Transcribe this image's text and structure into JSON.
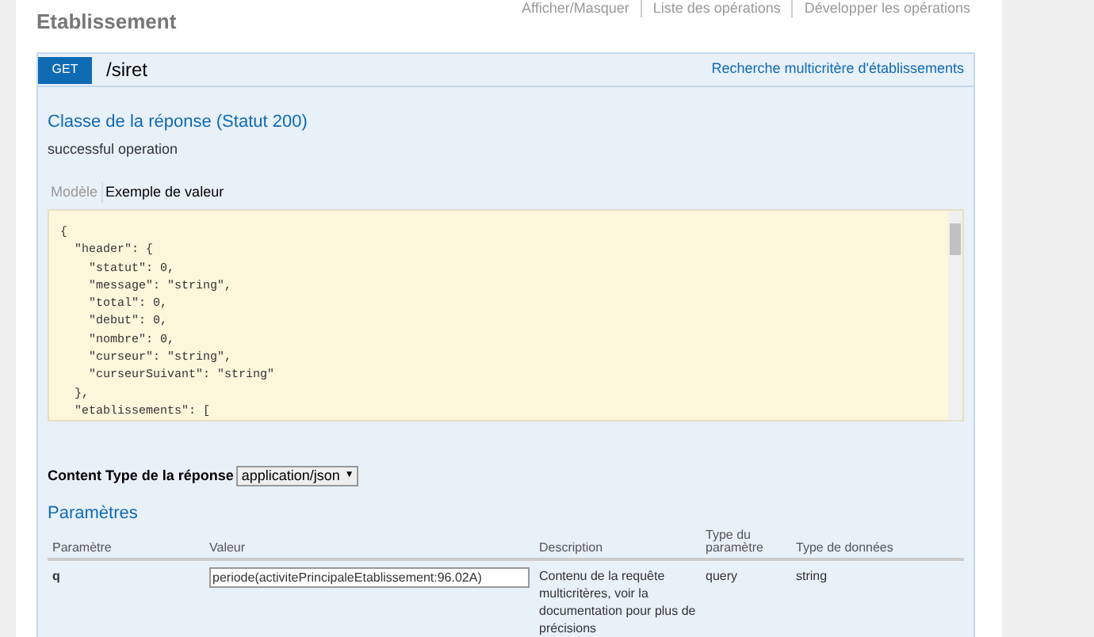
{
  "page_title": "Etablissement",
  "top_links": [
    "Afficher/Masquer",
    "Liste des opérations",
    "Développer les opérations"
  ],
  "operation": {
    "method": "GET",
    "path": "/siret",
    "summary": "Recherche multicritère d'établissements"
  },
  "response": {
    "title": "Classe de la réponse (Statut 200)",
    "description": "successful operation",
    "tabs": [
      {
        "label": "Modèle",
        "selected": false
      },
      {
        "label": "Exemple de valeur",
        "selected": true
      }
    ],
    "code_lines": [
      "{",
      "  \"header\": {",
      "    \"statut\": 0,",
      "    \"message\": \"string\",",
      "    \"total\": 0,",
      "    \"debut\": 0,",
      "    \"nombre\": 0,",
      "    \"curseur\": \"string\",",
      "    \"curseurSuivant\": \"string\"",
      "  },",
      "  \"etablissements\": ["
    ]
  },
  "content_type": {
    "label": "Content Type de la réponse",
    "value": "application/json",
    "caret": "▼"
  },
  "parameters": {
    "title": "Paramètres",
    "columns": [
      "Paramètre",
      "Valeur",
      "Description",
      "Type du paramètre",
      "Type de données"
    ],
    "rows": [
      {
        "name": "q",
        "value": "periode(activitePrincipaleEtablissement:96.02A)",
        "description": "Contenu de la requête multicritères, voir la documentation pour plus de précisions",
        "param_type": "query",
        "data_type": "string"
      }
    ]
  }
}
